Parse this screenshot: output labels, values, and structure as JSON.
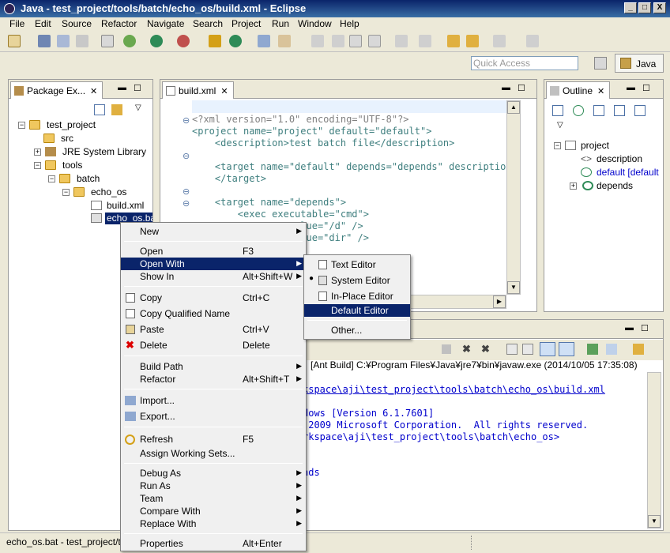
{
  "window": {
    "title": "Java - test_project/tools/batch/echo_os/build.xml - Eclipse",
    "min": "_",
    "max": "□",
    "close": "X"
  },
  "menubar": [
    "File",
    "Edit",
    "Source",
    "Refactor",
    "Navigate",
    "Search",
    "Project",
    "Run",
    "Window",
    "Help"
  ],
  "toolbar": {
    "quick_access_placeholder": "Quick Access",
    "perspective": "Java"
  },
  "package_explorer": {
    "tab": "Package Ex...",
    "tree": [
      {
        "label": "test_project"
      },
      {
        "label": "src"
      },
      {
        "label": "JRE System Library"
      },
      {
        "label": "tools"
      },
      {
        "label": "batch"
      },
      {
        "label": "echo_os"
      },
      {
        "label": "build.xml"
      },
      {
        "label": "echo_os.bat"
      }
    ]
  },
  "editor": {
    "tab": "build.xml",
    "lines": [
      "<?xml version=\"1.0\" encoding=\"UTF-8\"?>",
      "<project name=\"project\" default=\"default\">",
      "    <description>test batch file</description>",
      "",
      "    <target name=\"default\" depends=\"depends\" description=",
      "    </target>",
      "",
      "    <target name=\"depends\">",
      "        <exec executable=\"cmd\">",
      "            <arg value=\"/d\" />",
      "            <arg value=\"dir\" />"
    ]
  },
  "outline": {
    "tab": "Outline",
    "tree": [
      {
        "label": "project"
      },
      {
        "label": "description"
      },
      {
        "label": "default [default"
      },
      {
        "label": "depends"
      }
    ]
  },
  "console": {
    "header": "[Ant Build] C:¥Program Files¥Java¥jre7¥bin¥javaw.exe (2014/10/05 17:35:08)",
    "lines": [
      "kspace\\aji\\test_project\\tools\\batch\\echo_os\\build.xml",
      "",
      "dows [Version 6.1.7601]",
      " 2009 Microsoft Corporation.  All rights reserved.",
      "rkspace\\aji\\test_project\\tools\\batch\\echo_os>",
      "",
      "",
      "nds"
    ]
  },
  "context_menu": {
    "items": [
      {
        "label": "New",
        "accel": "",
        "submenu": true
      },
      {
        "label": "Open",
        "accel": "F3"
      },
      {
        "label": "Open With",
        "accel": "",
        "submenu": true
      },
      {
        "label": "Show In",
        "accel": "Alt+Shift+W",
        "submenu": true
      },
      {
        "label": "Copy",
        "accel": "Ctrl+C"
      },
      {
        "label": "Copy Qualified Name",
        "accel": ""
      },
      {
        "label": "Paste",
        "accel": "Ctrl+V"
      },
      {
        "label": "Delete",
        "accel": "Delete"
      },
      {
        "label": "Build Path",
        "accel": "",
        "submenu": true
      },
      {
        "label": "Refactor",
        "accel": "Alt+Shift+T",
        "submenu": true
      },
      {
        "label": "Import...",
        "accel": ""
      },
      {
        "label": "Export...",
        "accel": ""
      },
      {
        "label": "Refresh",
        "accel": "F5"
      },
      {
        "label": "Assign Working Sets...",
        "accel": ""
      },
      {
        "label": "Debug As",
        "accel": "",
        "submenu": true
      },
      {
        "label": "Run As",
        "accel": "",
        "submenu": true
      },
      {
        "label": "Team",
        "accel": "",
        "submenu": true
      },
      {
        "label": "Compare With",
        "accel": "",
        "submenu": true
      },
      {
        "label": "Replace With",
        "accel": "",
        "submenu": true
      },
      {
        "label": "Properties",
        "accel": "Alt+Enter"
      }
    ]
  },
  "open_with_menu": {
    "items": [
      {
        "label": "Text Editor"
      },
      {
        "label": "System Editor"
      },
      {
        "label": "In-Place Editor"
      },
      {
        "label": "Default Editor"
      },
      {
        "label": "Other..."
      }
    ]
  },
  "statusbar": {
    "text": "echo_os.bat - test_project/to"
  },
  "colors": {
    "selection": "#0a246a",
    "title_start": "#0a246a",
    "title_end": "#3a6ea5"
  }
}
